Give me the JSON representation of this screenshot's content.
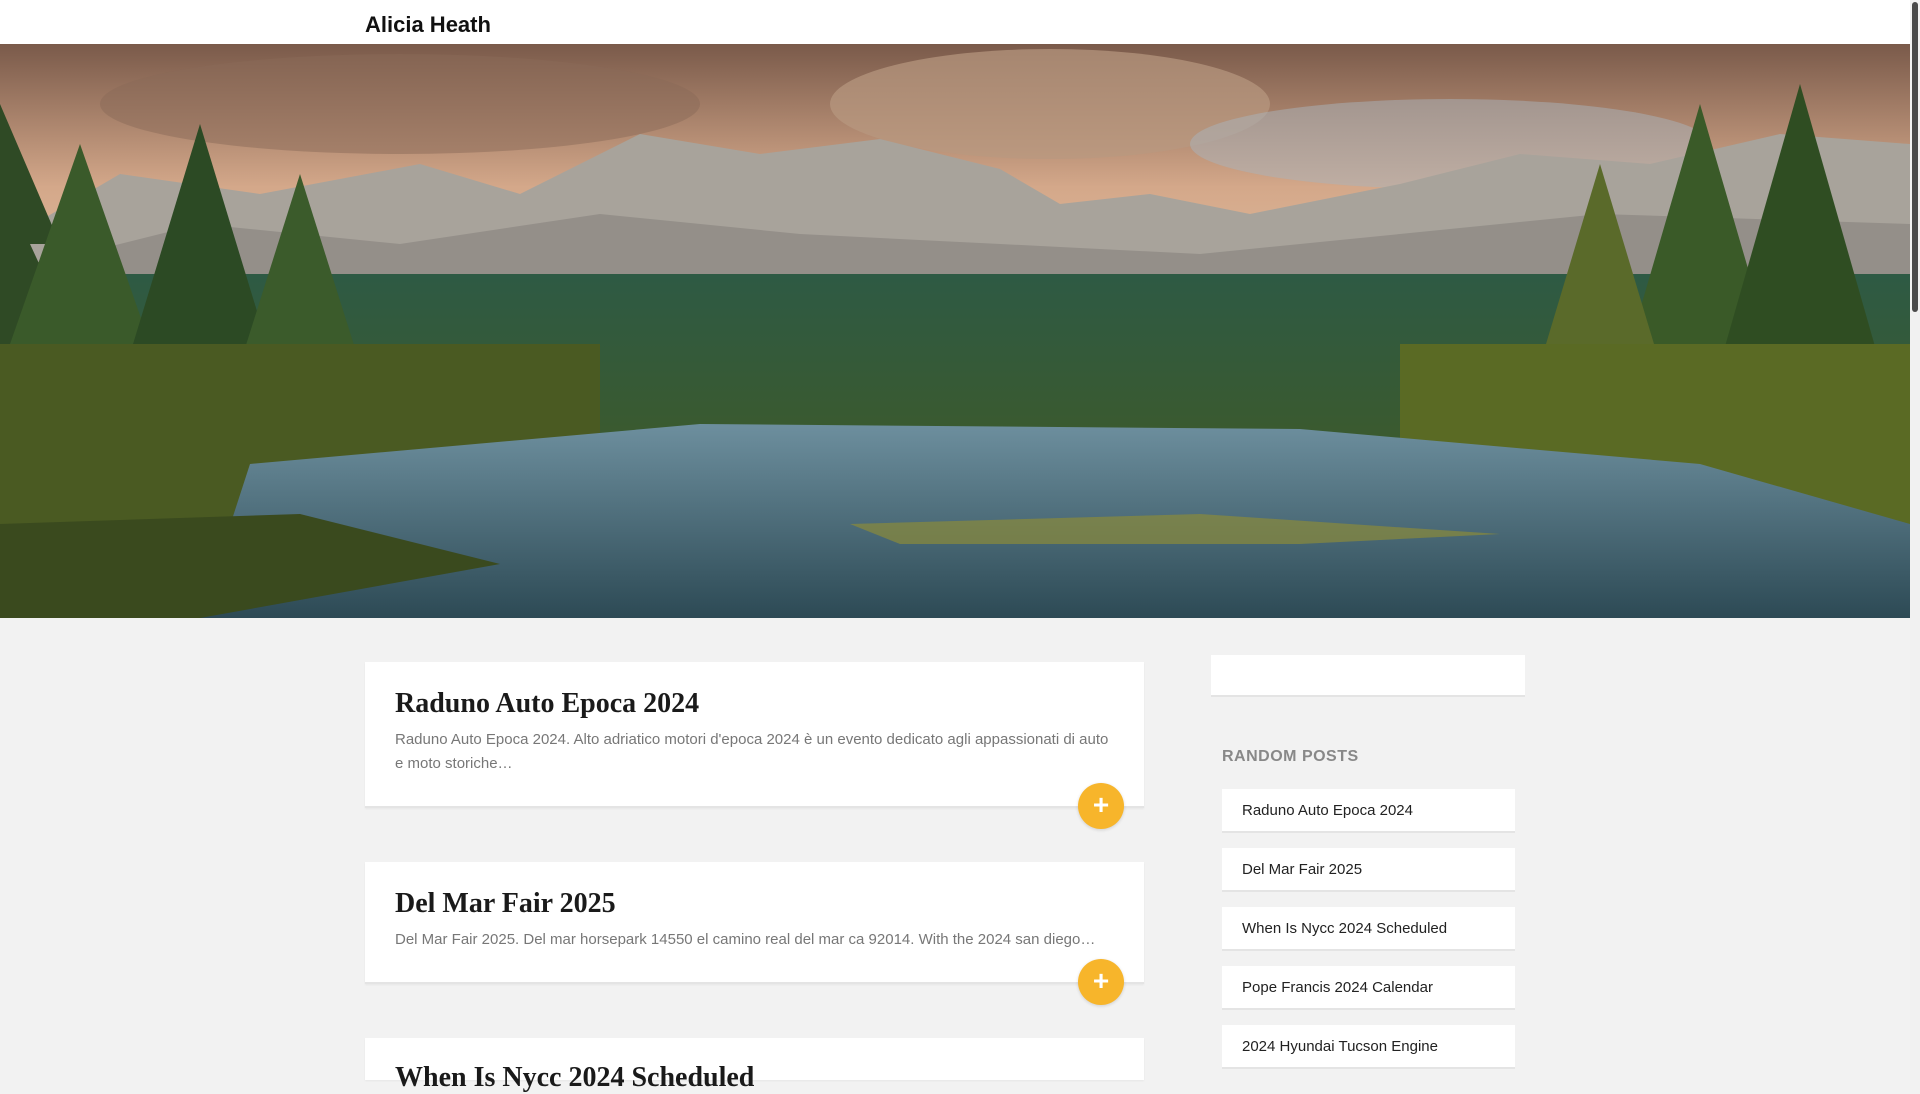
{
  "header": {
    "site_title": "Alicia Heath"
  },
  "hero": {
    "image_description": ""
  },
  "posts": [
    {
      "title": "Raduno Auto Epoca 2024",
      "excerpt": "Raduno Auto Epoca 2024. Alto adriatico motori d'epoca 2024 è un evento dedicato agli appassionati di auto e moto storiche…",
      "more_label": "+"
    },
    {
      "title": "Del Mar Fair 2025",
      "excerpt": "Del Mar Fair 2025. Del mar horsepark 14550 el camino real del mar ca 92014. With the 2024 san diego…",
      "more_label": "+"
    },
    {
      "title": "When Is Nycc 2024 Scheduled",
      "excerpt": "",
      "more_label": "+"
    }
  ],
  "sidebar": {
    "search": {
      "placeholder": ""
    },
    "random_posts": {
      "title": "RANDOM POSTS",
      "items": [
        "Raduno Auto Epoca 2024",
        "Del Mar Fair 2025",
        "When Is Nycc 2024 Scheduled",
        "Pope Francis 2024 Calendar",
        "2024 Hyundai Tucson Engine"
      ]
    }
  },
  "colors": {
    "accent": "#f7b52b",
    "background": "#f2f2f2",
    "card": "#ffffff"
  },
  "icons": {
    "more": "plus-icon"
  }
}
